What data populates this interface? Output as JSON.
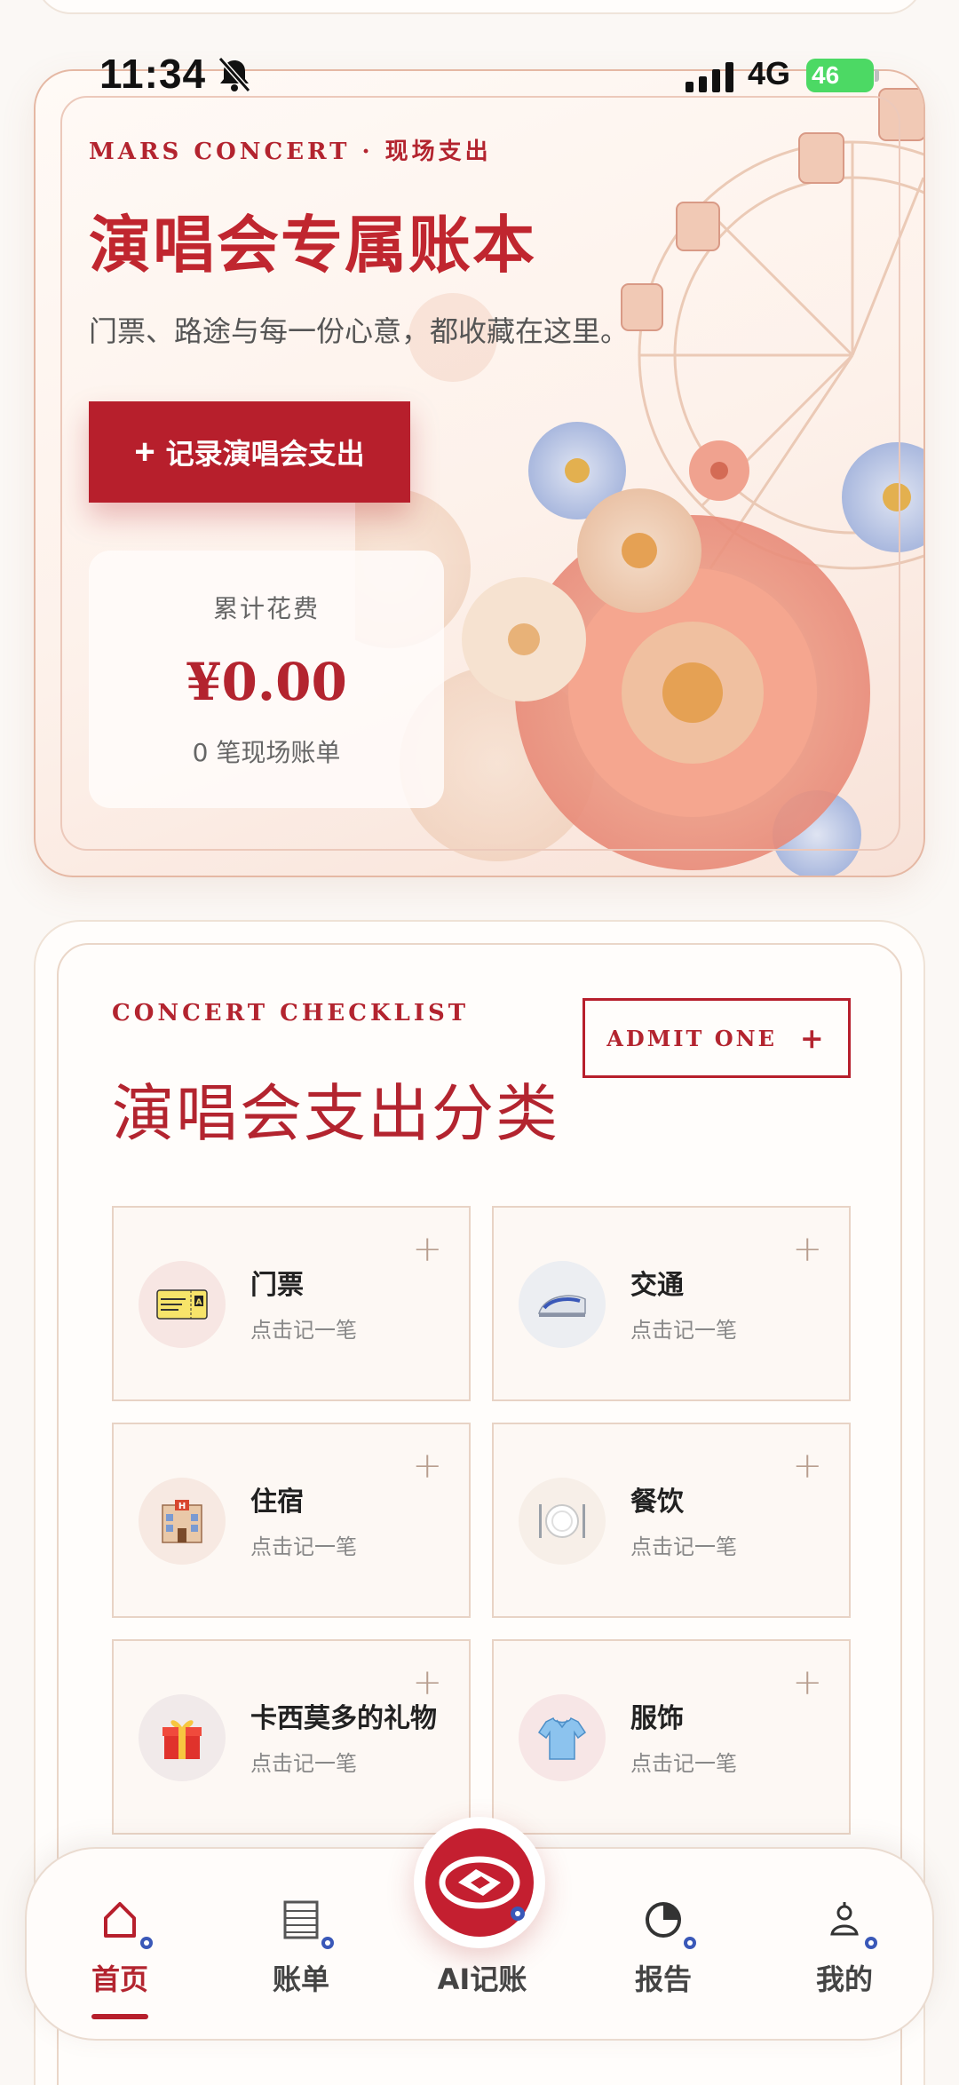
{
  "status_bar": {
    "time": "11:34",
    "network": "4G",
    "battery": "46"
  },
  "hero": {
    "kicker": "MARS CONCERT · 现场支出",
    "title": "演唱会专属账本",
    "subtitle": "门票、路途与每一份心意，都收藏在这里。",
    "cta_label": "记录演唱会支出",
    "cta_icon": "plus-icon",
    "total_label": "累计花费",
    "total_amount": "¥0.00",
    "total_count": "0 笔现场账单"
  },
  "checklist": {
    "kicker": "CONCERT CHECKLIST",
    "title": "演唱会支出分类",
    "admit_label": "ADMIT ONE",
    "categories": [
      {
        "name": "门票",
        "hint": "点击记一笔",
        "icon": "ticket-icon",
        "bg": "#f7e6e3"
      },
      {
        "name": "交通",
        "hint": "点击记一笔",
        "icon": "train-icon",
        "bg": "#eceef2"
      },
      {
        "name": "住宿",
        "hint": "点击记一笔",
        "icon": "hotel-icon",
        "bg": "#f7e9e2"
      },
      {
        "name": "餐饮",
        "hint": "点击记一笔",
        "icon": "plate-icon",
        "bg": "#f7efe8"
      },
      {
        "name": "卡西莫多的礼物",
        "hint": "点击记一笔",
        "icon": "gift-icon",
        "bg": "#f1eaea"
      },
      {
        "name": "服饰",
        "hint": "点击记一笔",
        "icon": "shirt-icon",
        "bg": "#f7e6e6"
      }
    ]
  },
  "nav": {
    "items": [
      {
        "label": "首页",
        "icon": "home-icon",
        "active": true
      },
      {
        "label": "账单",
        "icon": "list-icon",
        "active": false
      },
      {
        "label": "AI记账",
        "icon": "ai-logo-icon",
        "active": false
      },
      {
        "label": "报告",
        "icon": "pie-chart-icon",
        "active": false
      },
      {
        "label": "我的",
        "icon": "profile-icon",
        "active": false
      }
    ]
  },
  "colors": {
    "accent": "#b71f2c",
    "sparkle": "#3a58b8"
  }
}
